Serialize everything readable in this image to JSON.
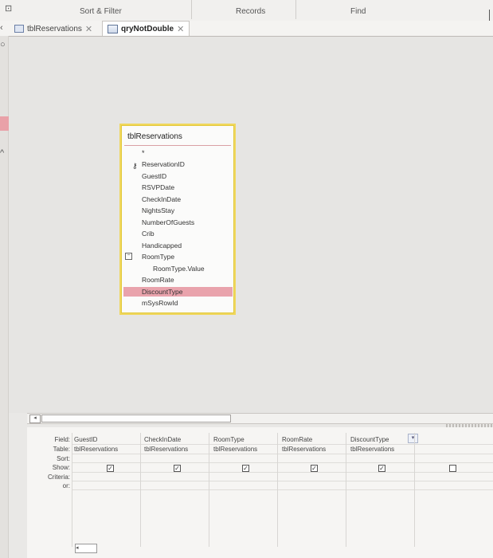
{
  "ribbon": {
    "groups": [
      "Sort & Filter",
      "Records",
      "Find"
    ]
  },
  "tabs": [
    {
      "label": "tblReservations",
      "active": false,
      "icon": "table-icon"
    },
    {
      "label": "qryNotDouble",
      "active": true,
      "icon": "query-icon"
    }
  ],
  "table_box": {
    "title": "tblReservations",
    "star": "*",
    "fields": [
      "ReservationID",
      "GuestID",
      "RSVPDate",
      "CheckInDate",
      "NightsStay",
      "NumberOfGuests",
      "Crib",
      "Handicapped",
      "RoomType"
    ],
    "subfield": "RoomType.Value",
    "fields_after": [
      "RoomRate",
      "DiscountType",
      "mSysRowId"
    ],
    "highlighted": "DiscountType"
  },
  "qbe": {
    "row_labels": [
      "Field:",
      "Table:",
      "Sort:",
      "Show:",
      "Criteria:",
      "or:"
    ],
    "columns": [
      {
        "field": "GuestID",
        "table": "tblReservations",
        "show": true
      },
      {
        "field": "CheckInDate",
        "table": "tblReservations",
        "show": true
      },
      {
        "field": "RoomType",
        "table": "tblReservations",
        "show": true
      },
      {
        "field": "RoomRate",
        "table": "tblReservations",
        "show": true
      },
      {
        "field": "DiscountType",
        "table": "tblReservations",
        "show": true
      },
      {
        "field": "",
        "table": "",
        "show": false
      }
    ]
  },
  "colors": {
    "highlight": "#e9a3ac",
    "table_box_border": "#f0d75c"
  }
}
